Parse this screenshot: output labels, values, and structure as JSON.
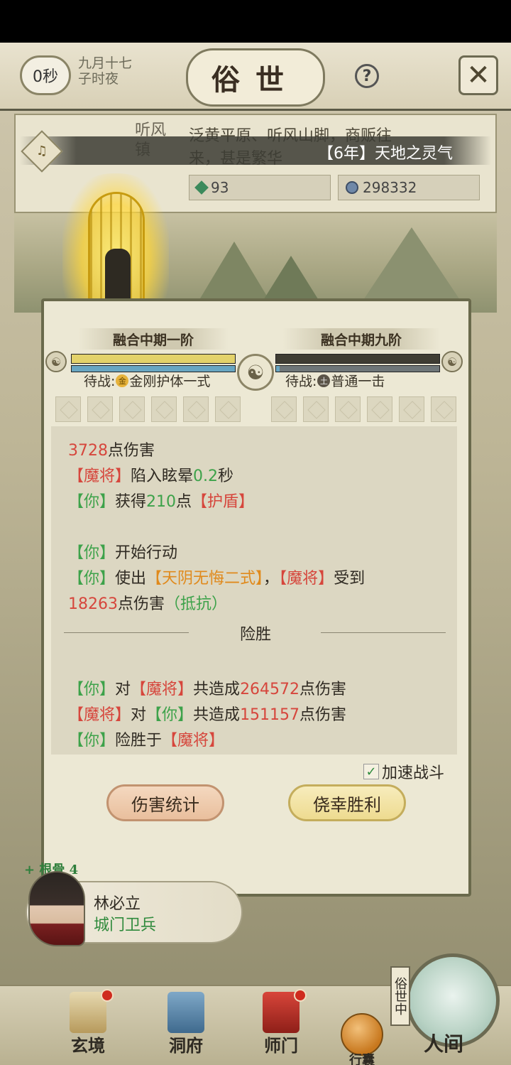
{
  "header": {
    "timer": "0秒",
    "date_line1": "九月十七",
    "date_line2": "子时夜",
    "title": "俗世",
    "help_icon": "?",
    "close_icon": "✕"
  },
  "location": {
    "name": "听风镇",
    "description": "泛黄平原、听风山脚，商贩往来，甚是繁华",
    "resource_jade": "93",
    "resource_coin": "298332"
  },
  "notice": {
    "text": "【6年】天地之灵气",
    "bell_icon": "bell-icon"
  },
  "battle": {
    "left_fighter": {
      "realm": "融合中期一阶",
      "hp_ratio": 1.0,
      "mp_ratio": 1.0,
      "standby_label": "待战:",
      "element": "金",
      "skill": "金刚护体一式"
    },
    "right_fighter": {
      "realm": "融合中期九阶",
      "hp_ratio": 0.0,
      "mp_ratio": 0.02,
      "standby_label": "待战:",
      "element": "土",
      "skill": "普通一击"
    },
    "log": {
      "l1_dmg": "3728",
      "l1_text": "点伤害",
      "l2_target": "【魔将】",
      "l2_text": "陷入眩晕",
      "l2_val": "0.2",
      "l2_unit": "秒",
      "l3_you": "【你】",
      "l3_text": "获得",
      "l3_val": "210",
      "l3_mid": "点",
      "l3_tag": "【护盾】",
      "l4_you": "【你】",
      "l4_text": "开始行动",
      "l5_you": "【你】",
      "l5_text": "使出",
      "l5_skill": "【天阴无悔二式】",
      "l5_sep": "，",
      "l5_enemy": "【魔将】",
      "l5_tail": "受到",
      "l6_val": "18263",
      "l6_text": "点伤害",
      "l6_tag": "（抵抗）",
      "result": "险胜",
      "s1_you": "【你】",
      "s1_to": "对",
      "s1_enemy": "【魔将】",
      "s1_text": "共造成",
      "s1_val": "264572",
      "s1_tail": "点伤害",
      "s2_enemy": "【魔将】",
      "s2_to": "对",
      "s2_you": "【你】",
      "s2_text": "共造成",
      "s2_val": "151157",
      "s2_tail": "点伤害",
      "s3_you": "【你】",
      "s3_text": "险胜于",
      "s3_enemy": "【魔将】"
    },
    "speed_up_label": "加速战斗",
    "stats_button": "伤害统计",
    "win_button": "侥幸胜利"
  },
  "npc": {
    "bonus": "+ 根骨 4",
    "name": "林必立",
    "role": "城门卫兵"
  },
  "nav": {
    "items": [
      "玄境",
      "洞府",
      "师门"
    ],
    "bag": "行囊",
    "world_tag": "俗世中",
    "world": "人间"
  },
  "colors": {
    "damage": "#d6463c",
    "gain": "#3da24a",
    "skill": "#e08a1c"
  }
}
